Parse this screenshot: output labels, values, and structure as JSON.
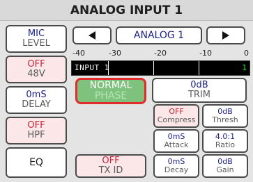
{
  "title": "ANALOG INPUT 1",
  "left_column": {
    "mic_level": {
      "top": "MIC",
      "bottom": "LEVEL"
    },
    "phantom": {
      "top": "OFF",
      "bottom": "48V"
    },
    "delay": {
      "top": "0mS",
      "bottom": "DELAY"
    },
    "hpf": {
      "top": "OFF",
      "bottom": "HPF"
    },
    "eq": {
      "label": "EQ"
    }
  },
  "channel_selector": {
    "name": "ANALOG 1",
    "prev_icon": "triangle-left",
    "next_icon": "triangle-right"
  },
  "meter": {
    "scale_labels": [
      "-40",
      "-30",
      "-20",
      "-10",
      "0"
    ],
    "channel_label": "INPUT 1",
    "channel_number": "1",
    "colors": {
      "background": "#000000",
      "text": "#ffffff",
      "number": "#2ee62e"
    }
  },
  "phase": {
    "top": "NORMAL",
    "bottom": "PHASE"
  },
  "trim": {
    "top": "0dB",
    "bottom": "TRIM"
  },
  "dynamics": {
    "compress": {
      "top": "OFF",
      "bottom": "Compress"
    },
    "thresh": {
      "top": "0dB",
      "bottom": "Thresh"
    },
    "attack": {
      "top": "0mS",
      "bottom": "Attack"
    },
    "ratio": {
      "top": "4.0:1",
      "bottom": "Ratio"
    },
    "decay": {
      "top": "0mS",
      "bottom": "Decay"
    },
    "gain": {
      "top": "0dB",
      "bottom": "Gain"
    }
  },
  "tx_id": {
    "top": "OFF",
    "bottom": "TX ID"
  },
  "colors": {
    "accent_blue": "#1b1f8a",
    "off_red": "#c8243a",
    "pink_bg": "#fbe6e8",
    "phase_green": "#7ec27e",
    "highlight_red": "#e12c2c"
  }
}
